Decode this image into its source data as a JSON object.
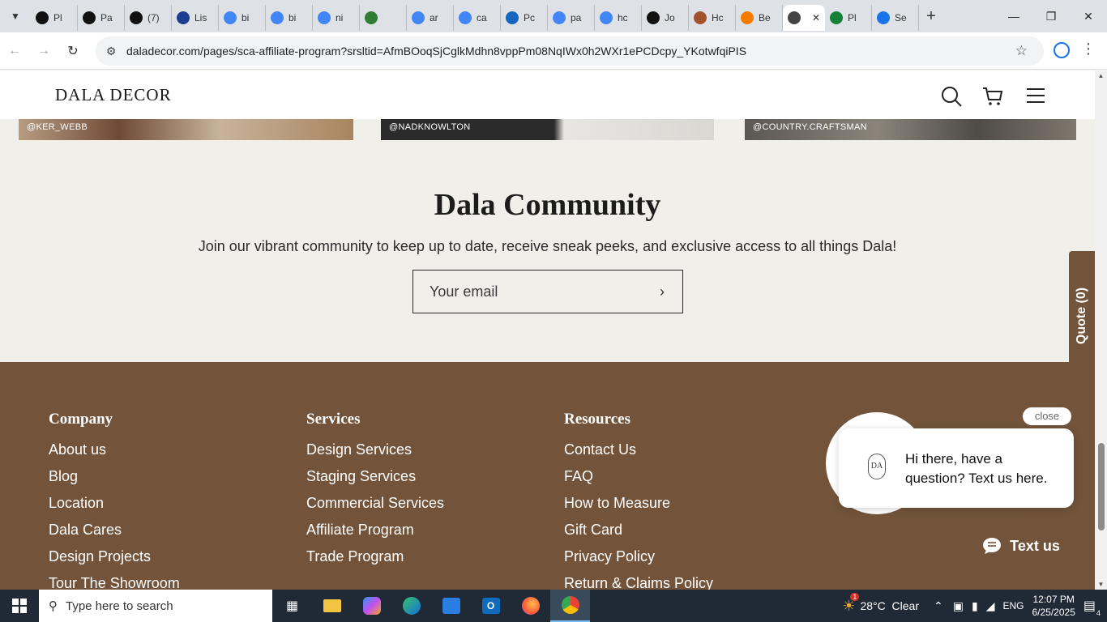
{
  "browser": {
    "tabs": [
      {
        "label": "Pl",
        "color": "#111111"
      },
      {
        "label": "Pa",
        "color": "#111111"
      },
      {
        "label": "(7)",
        "color": "#111111"
      },
      {
        "label": "Lis",
        "color": "#1a3d8f"
      },
      {
        "label": "bi",
        "color": "#4285f4"
      },
      {
        "label": "bi",
        "color": "#4285f4"
      },
      {
        "label": "ni",
        "color": "#4285f4"
      },
      {
        "label": "",
        "color": "#2e7d32"
      },
      {
        "label": "ar",
        "color": "#4285f4"
      },
      {
        "label": "ca",
        "color": "#4285f4"
      },
      {
        "label": "Pc",
        "color": "#1565c0"
      },
      {
        "label": "pa",
        "color": "#4285f4"
      },
      {
        "label": "hc",
        "color": "#4285f4"
      },
      {
        "label": "Jo",
        "color": "#111111"
      },
      {
        "label": "Hc",
        "color": "#a0522d"
      },
      {
        "label": "Be",
        "color": "#f57c00"
      },
      {
        "label": "",
        "color": "#444444"
      },
      {
        "label": "Pl",
        "color": "#188038"
      },
      {
        "label": "Se",
        "color": "#1a73e8"
      }
    ],
    "url": "daladecor.com/pages/sca-affiliate-program?srsltid=AfmBOoqSjCglkMdhn8vppPm08NqIWx0h2WXr1ePCDcpy_YKotwfqiPIS"
  },
  "site": {
    "logo": "DALA DECOR",
    "instagram": [
      "@KER_WEBB",
      "@NADKNOWLTON",
      "@COUNTRY.CRAFTSMAN"
    ],
    "community": {
      "title": "Dala Community",
      "subtitle": "Join our vibrant community to keep up to date, receive sneak peeks, and exclusive access to all things Dala!",
      "email_placeholder": "Your email"
    },
    "footer": {
      "company": {
        "title": "Company",
        "links": [
          "About us",
          "Blog",
          "Location",
          "Dala Cares",
          "Design Projects",
          "Tour The Showroom"
        ]
      },
      "services": {
        "title": "Services",
        "links": [
          "Design Services",
          "Staging Services",
          "Commercial Services",
          "Affiliate Program",
          "Trade Program"
        ]
      },
      "resources": {
        "title": "Resources",
        "links": [
          "Contact Us",
          "FAQ",
          "How to Measure",
          "Gift Card",
          "Privacy Policy",
          "Return & Claims Policy"
        ]
      }
    },
    "quote_tab": "Quote (0)",
    "chat": {
      "close": "close",
      "message": "Hi there, have a question? Text us here.",
      "button": "Text us"
    }
  },
  "taskbar": {
    "search_placeholder": "Type here to search",
    "weather": "28°C  Clear",
    "weather_badge": "1",
    "language": "ENG",
    "time": "12:07 PM",
    "date": "6/25/2025",
    "notifications": "4"
  },
  "colors": {
    "footer_brown": "#73543b",
    "community_bg": "#f1efe9"
  }
}
